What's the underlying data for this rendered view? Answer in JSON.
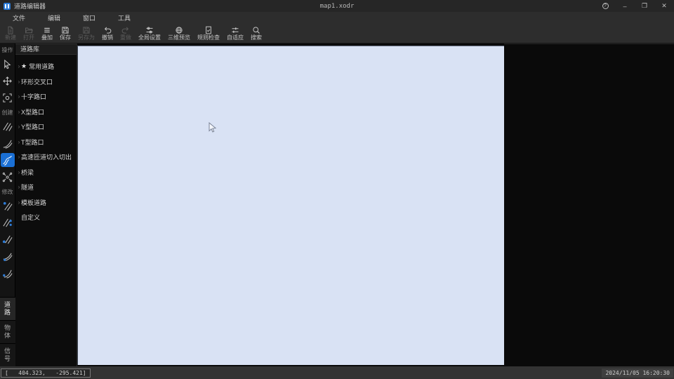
{
  "titlebar": {
    "app_title": "道路编辑器",
    "document": "map1.xodr",
    "controls": [
      {
        "name": "help",
        "glyph": "?"
      },
      {
        "name": "minimize",
        "glyph": "–"
      },
      {
        "name": "restore",
        "glyph": "❐"
      },
      {
        "name": "close",
        "glyph": "✕"
      }
    ]
  },
  "menubar": {
    "items": [
      "文件",
      "编辑",
      "窗口",
      "工具"
    ]
  },
  "toolbar": {
    "items": [
      {
        "label": "新建",
        "icon": "new-file",
        "enabled": false
      },
      {
        "label": "打开",
        "icon": "open-file",
        "enabled": false
      },
      {
        "label": "叠加",
        "icon": "overlay",
        "enabled": true
      },
      {
        "label": "保存",
        "icon": "save",
        "enabled": true
      },
      {
        "label": "另存为",
        "icon": "save-as",
        "enabled": false
      },
      {
        "label": "撤销",
        "icon": "undo",
        "enabled": true
      },
      {
        "label": "重做",
        "icon": "redo",
        "enabled": false
      },
      {
        "label": "全局设置",
        "icon": "global-settings",
        "enabled": true
      },
      {
        "label": "三维预览",
        "icon": "preview-3d",
        "enabled": true
      },
      {
        "label": "规则检查",
        "icon": "rule-check",
        "enabled": true
      },
      {
        "label": "自适应",
        "icon": "auto-fit",
        "enabled": true
      },
      {
        "label": "搜索",
        "icon": "search",
        "enabled": true
      }
    ]
  },
  "tool_strip": {
    "groups": [
      {
        "label": "操作",
        "tools": [
          {
            "icon": "select-cursor",
            "name": "select-tool",
            "selected": false
          },
          {
            "icon": "move",
            "name": "pan-tool",
            "selected": false
          },
          {
            "icon": "focus-extent",
            "name": "focus-extent-tool",
            "selected": false
          }
        ]
      },
      {
        "label": "创建",
        "tools": [
          {
            "icon": "straight-road",
            "name": "straight-road-tool",
            "selected": false
          },
          {
            "icon": "curved-road",
            "name": "curved-road-tool",
            "selected": false
          },
          {
            "icon": "s-curve-road",
            "name": "s-curve-road-tool",
            "selected": true
          },
          {
            "icon": "junction",
            "name": "junction-tool",
            "selected": false
          }
        ]
      },
      {
        "label": "修改",
        "tools": [
          {
            "icon": "lane-edit-1",
            "name": "modify-lane-tool-1",
            "selected": false
          },
          {
            "icon": "lane-edit-2",
            "name": "modify-lane-tool-2",
            "selected": false
          },
          {
            "icon": "lane-edit-3",
            "name": "modify-lane-tool-3",
            "selected": false
          },
          {
            "icon": "lane-edit-4",
            "name": "modify-lane-tool-4",
            "selected": false
          },
          {
            "icon": "lane-edit-5",
            "name": "modify-lane-tool-5",
            "selected": false
          }
        ]
      }
    ],
    "tabs": [
      {
        "label": "道路",
        "active": true
      },
      {
        "label": "物体",
        "active": false
      },
      {
        "label": "信号",
        "active": false
      }
    ]
  },
  "library": {
    "title": "道路库",
    "items": [
      {
        "label": "常用道路",
        "star": true,
        "expandable": true
      },
      {
        "label": "环形交叉口",
        "star": false,
        "expandable": true
      },
      {
        "label": "十字路口",
        "star": false,
        "expandable": true
      },
      {
        "label": "X型路口",
        "star": false,
        "expandable": true
      },
      {
        "label": "Y型路口",
        "star": false,
        "expandable": true
      },
      {
        "label": "T型路口",
        "star": false,
        "expandable": true
      },
      {
        "label": "高速匝道切入切出",
        "star": false,
        "expandable": true
      },
      {
        "label": "桥梁",
        "star": false,
        "expandable": true
      },
      {
        "label": "隧道",
        "star": false,
        "expandable": true
      },
      {
        "label": "模板道路",
        "star": false,
        "expandable": true
      },
      {
        "label": "自定义",
        "star": false,
        "expandable": false
      }
    ]
  },
  "statusbar": {
    "coordinates": "[   404.323,   -295.421]",
    "timestamp": "2024/11/05 16:20:30"
  },
  "colors": {
    "accent_blue": "#1a6fd4",
    "canvas_background": "#d9e2f4",
    "chrome_dark": "#2d2d2d",
    "panel_dark": "#0c0c0c"
  }
}
